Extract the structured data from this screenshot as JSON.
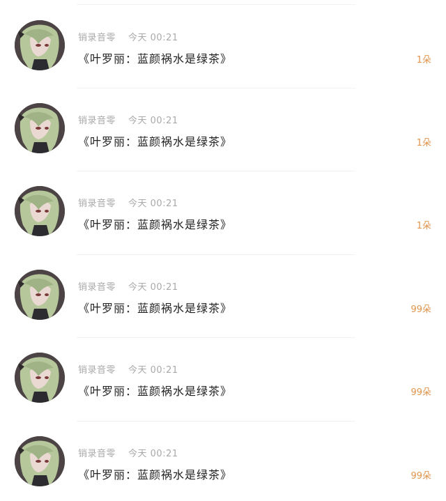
{
  "colors": {
    "count": "#e0944b",
    "meta": "#a9a9a9",
    "title": "#222222"
  },
  "rows": [
    {
      "author": "销录音零",
      "time": "今天 00:21",
      "title": "《叶罗丽：蓝颜祸水是绿茶》",
      "count": "1朵",
      "avatar_icon": "anime-avatar-icon"
    },
    {
      "author": "销录音零",
      "time": "今天 00:21",
      "title": "《叶罗丽：蓝颜祸水是绿茶》",
      "count": "1朵",
      "avatar_icon": "anime-avatar-icon"
    },
    {
      "author": "销录音零",
      "time": "今天 00:21",
      "title": "《叶罗丽：蓝颜祸水是绿茶》",
      "count": "1朵",
      "avatar_icon": "anime-avatar-icon"
    },
    {
      "author": "销录音零",
      "time": "今天 00:21",
      "title": "《叶罗丽：蓝颜祸水是绿茶》",
      "count": "99朵",
      "avatar_icon": "anime-avatar-icon"
    },
    {
      "author": "销录音零",
      "time": "今天 00:21",
      "title": "《叶罗丽：蓝颜祸水是绿茶》",
      "count": "99朵",
      "avatar_icon": "anime-avatar-icon"
    },
    {
      "author": "销录音零",
      "time": "今天 00:21",
      "title": "《叶罗丽：蓝颜祸水是绿茶》",
      "count": "99朵",
      "avatar_icon": "anime-avatar-icon"
    }
  ]
}
